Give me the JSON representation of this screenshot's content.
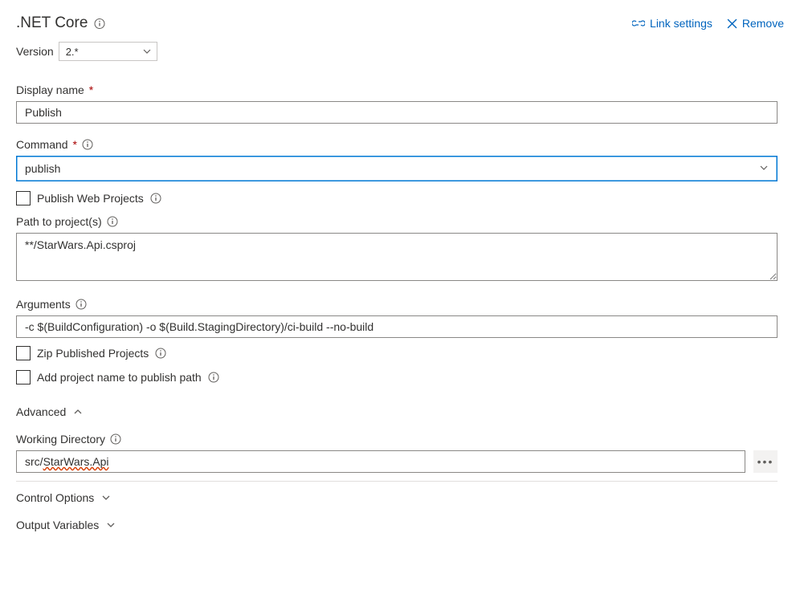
{
  "header": {
    "title": ".NET Core",
    "link_settings": "Link settings",
    "remove": "Remove"
  },
  "version": {
    "label": "Version",
    "value": "2.*"
  },
  "display_name": {
    "label": "Display name",
    "value": "Publish"
  },
  "command": {
    "label": "Command",
    "value": "publish"
  },
  "publish_web": {
    "label": "Publish Web Projects"
  },
  "path_projects": {
    "label": "Path to project(s)",
    "value": "**/StarWars.Api.csproj"
  },
  "arguments": {
    "label": "Arguments",
    "value": "-c $(BuildConfiguration) -o $(Build.StagingDirectory)/ci-build --no-build"
  },
  "zip_published": {
    "label": "Zip Published Projects"
  },
  "add_project_name": {
    "label": "Add project name to publish path"
  },
  "advanced": {
    "title": "Advanced"
  },
  "working_dir": {
    "label": "Working Directory",
    "prefix": "src/",
    "spelled": "StarWars.Api"
  },
  "control_options": {
    "title": "Control Options"
  },
  "output_variables": {
    "title": "Output Variables"
  }
}
